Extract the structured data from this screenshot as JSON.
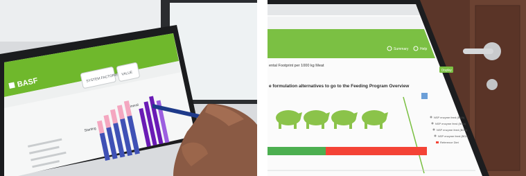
{
  "left_photo": {
    "app_header": {
      "logo_text": "BASF",
      "brand_color": "#6fb82c"
    },
    "tab_labels": [
      {
        "label": "SYSTEM FACTORIES"
      },
      {
        "label": "VALUE"
      }
    ],
    "panel_headings": [
      {
        "label": "Starting"
      },
      {
        "label": "Mineral"
      }
    ],
    "bar_colors": {
      "pink": "#f4a7c0",
      "blue": "#3f51b5",
      "purple": "#6a1bb5"
    }
  },
  "right_photo": {
    "toolbar": {
      "search_label": "Summary",
      "user_label": "Help",
      "brand_color": "#7bc043"
    },
    "page_title": "ental Footprint per 1000 kg Meat",
    "action_button": "Display",
    "section_title": "e formulation alternatives to go to the Feeding Program Overview",
    "legend": [
      {
        "label": "NSP enzyme feed (BGA)"
      },
      {
        "label": "NSP enzyme feed (BGA)"
      },
      {
        "label": "NSP enzyme feed (BGA)"
      },
      {
        "label": "NSP enzyme feed (BGA)"
      },
      {
        "label": "Reference Diet"
      }
    ],
    "colors": {
      "pig": "#8bc34a",
      "bar_green": "#4caf50",
      "bar_red": "#f44336"
    }
  }
}
